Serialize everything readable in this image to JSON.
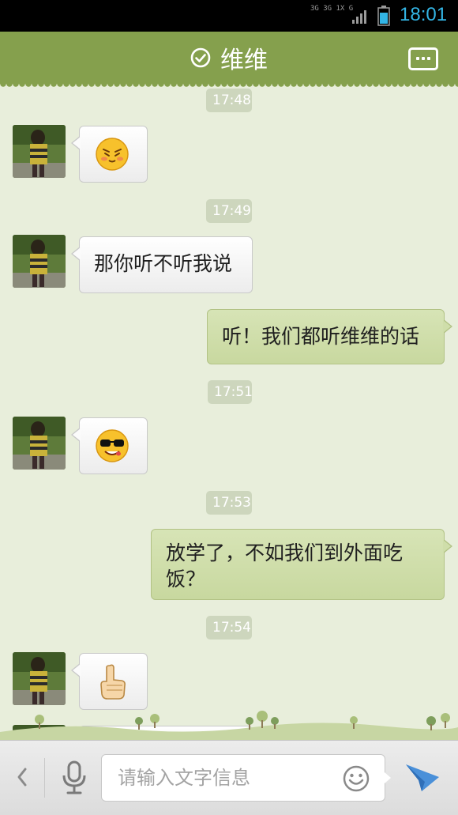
{
  "status_bar": {
    "network_text": "3G 3G 1X G",
    "time": "18:01",
    "time_color": "#33b5e5"
  },
  "header": {
    "title": "维维",
    "verified_icon": "check-circle-icon",
    "menu_icon": "more-dots-icon",
    "background_color": "#85a04d"
  },
  "messages": [
    {
      "type": "timestamp",
      "text": "17:48"
    },
    {
      "type": "incoming",
      "kind": "emoji",
      "emoji": "blushing-face-emoji"
    },
    {
      "type": "timestamp",
      "text": "17:49"
    },
    {
      "type": "incoming",
      "kind": "text",
      "text": "那你听不听我说"
    },
    {
      "type": "outgoing",
      "kind": "text",
      "text": "听！我们都听维维的话"
    },
    {
      "type": "timestamp",
      "text": "17:51"
    },
    {
      "type": "incoming",
      "kind": "emoji",
      "emoji": "sunglasses-face-emoji"
    },
    {
      "type": "timestamp",
      "text": "17:53"
    },
    {
      "type": "outgoing",
      "kind": "text",
      "line1": "放学了，不如我们到外面吃",
      "line2": "饭？"
    },
    {
      "type": "timestamp",
      "text": "17:54"
    },
    {
      "type": "incoming",
      "kind": "emoji",
      "emoji": "pointing-up-hand-emoji"
    },
    {
      "type": "incoming",
      "kind": "partial"
    }
  ],
  "input_bar": {
    "placeholder": "请输入文字信息",
    "back_icon": "chevron-left-icon",
    "voice_icon": "microphone-icon",
    "emoji_icon": "smiley-icon",
    "send_icon": "paper-plane-icon"
  }
}
